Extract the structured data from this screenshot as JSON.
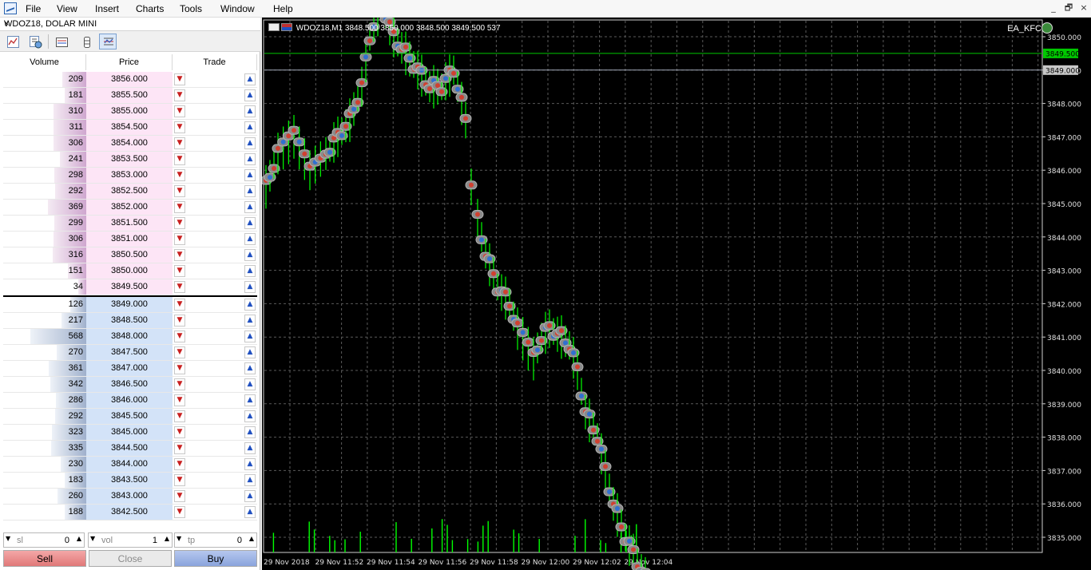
{
  "menu": {
    "items": [
      "File",
      "View",
      "Insert",
      "Charts",
      "Tools",
      "Window",
      "Help"
    ]
  },
  "window_controls": [
    "_",
    "🗗",
    "×"
  ],
  "panel": {
    "title": "WDOZ18, DOLAR MINI",
    "close": "×",
    "headers": {
      "volume": "Volume",
      "price": "Price",
      "trade": "Trade"
    },
    "asks": [
      {
        "volume": "209",
        "price": "3856.000"
      },
      {
        "volume": "181",
        "price": "3855.500"
      },
      {
        "volume": "310",
        "price": "3855.000"
      },
      {
        "volume": "311",
        "price": "3854.500"
      },
      {
        "volume": "306",
        "price": "3854.000"
      },
      {
        "volume": "241",
        "price": "3853.500"
      },
      {
        "volume": "298",
        "price": "3853.000"
      },
      {
        "volume": "292",
        "price": "3852.500"
      },
      {
        "volume": "369",
        "price": "3852.000"
      },
      {
        "volume": "299",
        "price": "3851.500"
      },
      {
        "volume": "306",
        "price": "3851.000"
      },
      {
        "volume": "316",
        "price": "3850.500"
      },
      {
        "volume": "151",
        "price": "3850.000"
      },
      {
        "volume": "34",
        "price": "3849.500"
      }
    ],
    "bids": [
      {
        "volume": "126",
        "price": "3849.000"
      },
      {
        "volume": "217",
        "price": "3848.500"
      },
      {
        "volume": "568",
        "price": "3848.000"
      },
      {
        "volume": "270",
        "price": "3847.500"
      },
      {
        "volume": "361",
        "price": "3847.000"
      },
      {
        "volume": "342",
        "price": "3846.500"
      },
      {
        "volume": "286",
        "price": "3846.000"
      },
      {
        "volume": "292",
        "price": "3845.500"
      },
      {
        "volume": "323",
        "price": "3845.000"
      },
      {
        "volume": "335",
        "price": "3844.500"
      },
      {
        "volume": "230",
        "price": "3844.000"
      },
      {
        "volume": "183",
        "price": "3843.500"
      },
      {
        "volume": "260",
        "price": "3843.000"
      },
      {
        "volume": "188",
        "price": "3842.500"
      }
    ],
    "inputs": {
      "sl": {
        "label": "sl",
        "value": "0"
      },
      "vol": {
        "label": "vol",
        "value": "1"
      },
      "tp": {
        "label": "tp",
        "value": "0"
      }
    },
    "buttons": {
      "sell": "Sell",
      "close": "Close",
      "buy": "Buy"
    }
  },
  "chart": {
    "header": "WDOZ18,M1  3848.500 3850.000 3848.500 3849.500  537",
    "ea": "EA_KFC",
    "colors": {
      "background": "#000000",
      "candle": "#00ff00",
      "grid": "#5a5a5a",
      "ask_line": "#00c800",
      "bid_line": "#a0a8b8"
    },
    "price_labels": [
      "3850.000",
      "3849.000",
      "3848.000",
      "3847.000",
      "3846.000",
      "3845.000",
      "3844.000",
      "3843.000",
      "3842.000",
      "3841.000",
      "3840.000",
      "3839.000",
      "3838.000",
      "3837.000",
      "3836.000",
      "3835.000"
    ],
    "ask_tag": "3849.500",
    "bid_tag": "3849.000",
    "time_labels": [
      "29 Nov 2018",
      "29 Nov 11:52",
      "29 Nov 11:54",
      "29 Nov 11:56",
      "29 Nov 11:58",
      "29 Nov 12:00",
      "29 Nov 12:02",
      "29 Nov 12:04"
    ]
  }
}
